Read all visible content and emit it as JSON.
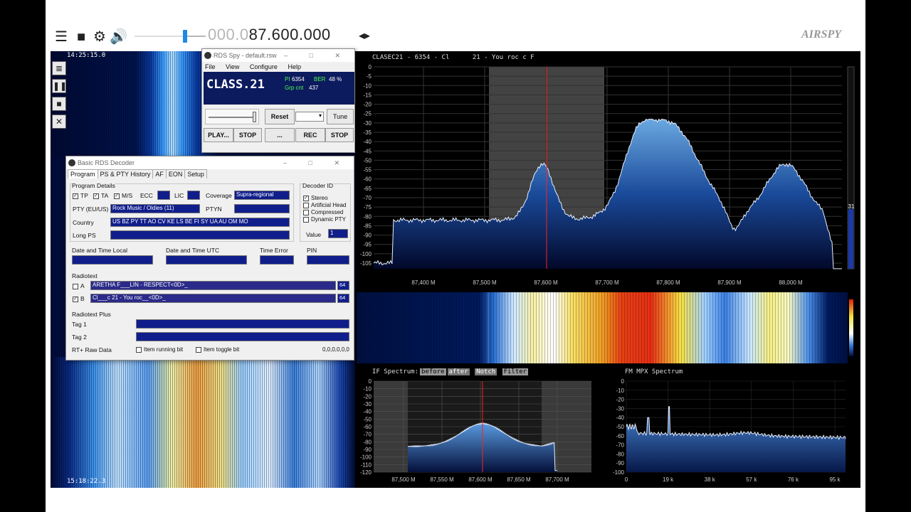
{
  "topbar": {
    "freq_dim": "000.0",
    "freq_main": "87.600.000",
    "freq_arrows": "◂▸",
    "logo": "AIRSPY",
    "volume_level": 0.72
  },
  "left_waterfall": {
    "time_top": "14:25:15.0",
    "time_bottom": "15:18:22.3"
  },
  "rds_spy": {
    "title": "RDS Spy - default.rsw",
    "menu": [
      "File",
      "View",
      "Configure",
      "Help"
    ],
    "ps": "CLASS.21",
    "pi_label": "PI",
    "pi_value": "6354",
    "ber_label": "BER",
    "ber_value": "48 %",
    "grp_label": "Grp cnt",
    "grp_value": "437",
    "reset": "Reset",
    "tune": "Tune",
    "play": "PLAY...",
    "stop1": "STOP",
    "dots": "...",
    "rec": "REC",
    "stop2": "STOP"
  },
  "basic_rds": {
    "title": "Basic RDS Decoder",
    "tabs": [
      "Program",
      "PS & PTY History",
      "AF",
      "EON",
      "Setup"
    ],
    "program_details": "Program Details",
    "tp": "TP",
    "ta": "TA",
    "ms": "M/S",
    "ecc": "ECC",
    "lic": "LIC",
    "coverage_label": "Coverage",
    "coverage_value": "Supra-regional",
    "pty_label": "PTY (EU/US)",
    "pty_value": "Rock Music / Oldies (11)",
    "ptyn_label": "PTYN",
    "country_label": "Country",
    "country_value": "US BZ PY TT AO CV KE LS BE FI SY UA AU OM MO",
    "longps_label": "Long PS",
    "decoder_id": "Decoder ID",
    "stereo": "Stereo",
    "art_head": "Artificial Head",
    "compressed": "Compressed",
    "dyn_pty": "Dynamic PTY",
    "value_label": "Value",
    "value_value": "1",
    "dt_local": "Date and Time Local",
    "dt_utc": "Date and Time UTC",
    "time_error": "Time Error",
    "pin": "PIN",
    "radiotext": "Radiotext",
    "rt_a_label": "A",
    "rt_a_value": "ARETHA F___LIN - RESPECT<0D>_",
    "rt_a_len": "64",
    "rt_b_label": "B",
    "rt_b_value": "Cl___c 21 - You roc__<0D>_",
    "rt_b_len": "64",
    "rt_plus": "Radiotext Plus",
    "tag1": "Tag 1",
    "tag2": "Tag 2",
    "rt_raw": "RT+ Raw Data",
    "item_running": "Item running bit",
    "item_toggle": "Item toggle bit",
    "raw_value": "0,0,0,0,0,0"
  },
  "main_spectrum": {
    "title": "CLASEC21 - 6354 - Cl      21 - You roc c F",
    "y_labels": [
      "0",
      "-5",
      "-10",
      "-15",
      "-20",
      "-25",
      "-30",
      "-35",
      "-40",
      "-45",
      "-50",
      "-55",
      "-60",
      "-65",
      "-70",
      "-75",
      "-80",
      "-85",
      "-90",
      "-95",
      "-100",
      "-105"
    ],
    "x_labels": [
      "87,400 M",
      "87,500 M",
      "87,600 M",
      "87,700 M",
      "87,800 M",
      "87,900 M",
      "88,000 M"
    ],
    "meter_value": "31",
    "squelch_label": "31"
  },
  "if_spectrum": {
    "title": "IF Spectrum:",
    "chip_before": "before",
    "chip_after": "after",
    "chip_notch": "Notch",
    "chip_filter": "Filter",
    "y_labels": [
      "0",
      "-10",
      "-20",
      "-30",
      "-40",
      "-50",
      "-60",
      "-70",
      "-80",
      "-90",
      "-100",
      "-110",
      "-120"
    ],
    "x_labels": [
      "87,500 M",
      "87,550 M",
      "87,600 M",
      "87,650 M",
      "87,700 M"
    ]
  },
  "mpx_spectrum": {
    "title": "FM MPX Spectrum",
    "y_labels": [
      "0",
      "-10",
      "-20",
      "-30",
      "-40",
      "-50",
      "-60",
      "-70",
      "-80",
      "-90",
      "-100"
    ],
    "x_labels": [
      "0",
      "19 k",
      "38 k",
      "57 k",
      "76 k",
      "95 k"
    ]
  },
  "colors": {
    "accent": "#1e88e5",
    "rds_field": "#101e8c",
    "tuning_line": "#ff2020"
  }
}
